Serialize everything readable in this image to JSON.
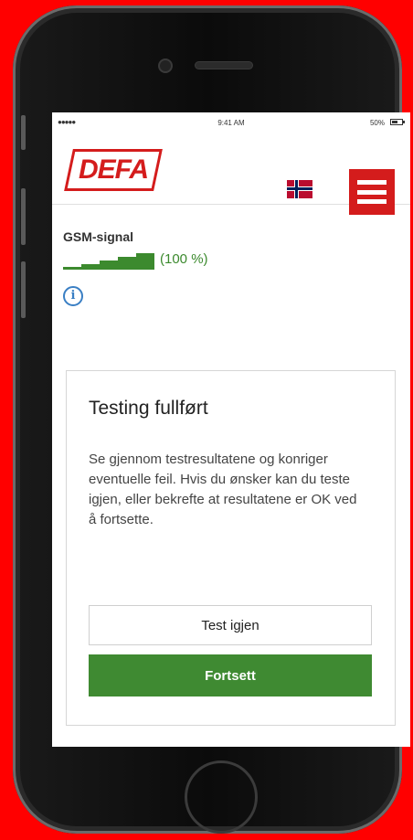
{
  "status_bar": {
    "signal": "●●●●● ",
    "time": "9:41 AM",
    "battery": "50%"
  },
  "header": {
    "logo_text": "DEFA",
    "language_flag": "norway-flag-icon",
    "menu_icon": "hamburger-menu-icon"
  },
  "gsm": {
    "label": "GSM-signal",
    "percent_text": "(100 %)",
    "signal_level": 1.0,
    "info_icon": "info-icon"
  },
  "card": {
    "title": "Testing fullført",
    "body": "Se gjennom testresultatene og konriger eventuelle feil. Hvis du ønsker kan du teste igjen, eller bekrefte at resultatene er OK ved å fortsette.",
    "retest_label": "Test igjen",
    "continue_label": "Fortsett"
  },
  "colors": {
    "brand_red": "#d41c1c",
    "signal_green": "#3c8a2e",
    "continue_green": "#3f8a32",
    "info_blue": "#3a7fc4",
    "background": "#ff0000"
  }
}
